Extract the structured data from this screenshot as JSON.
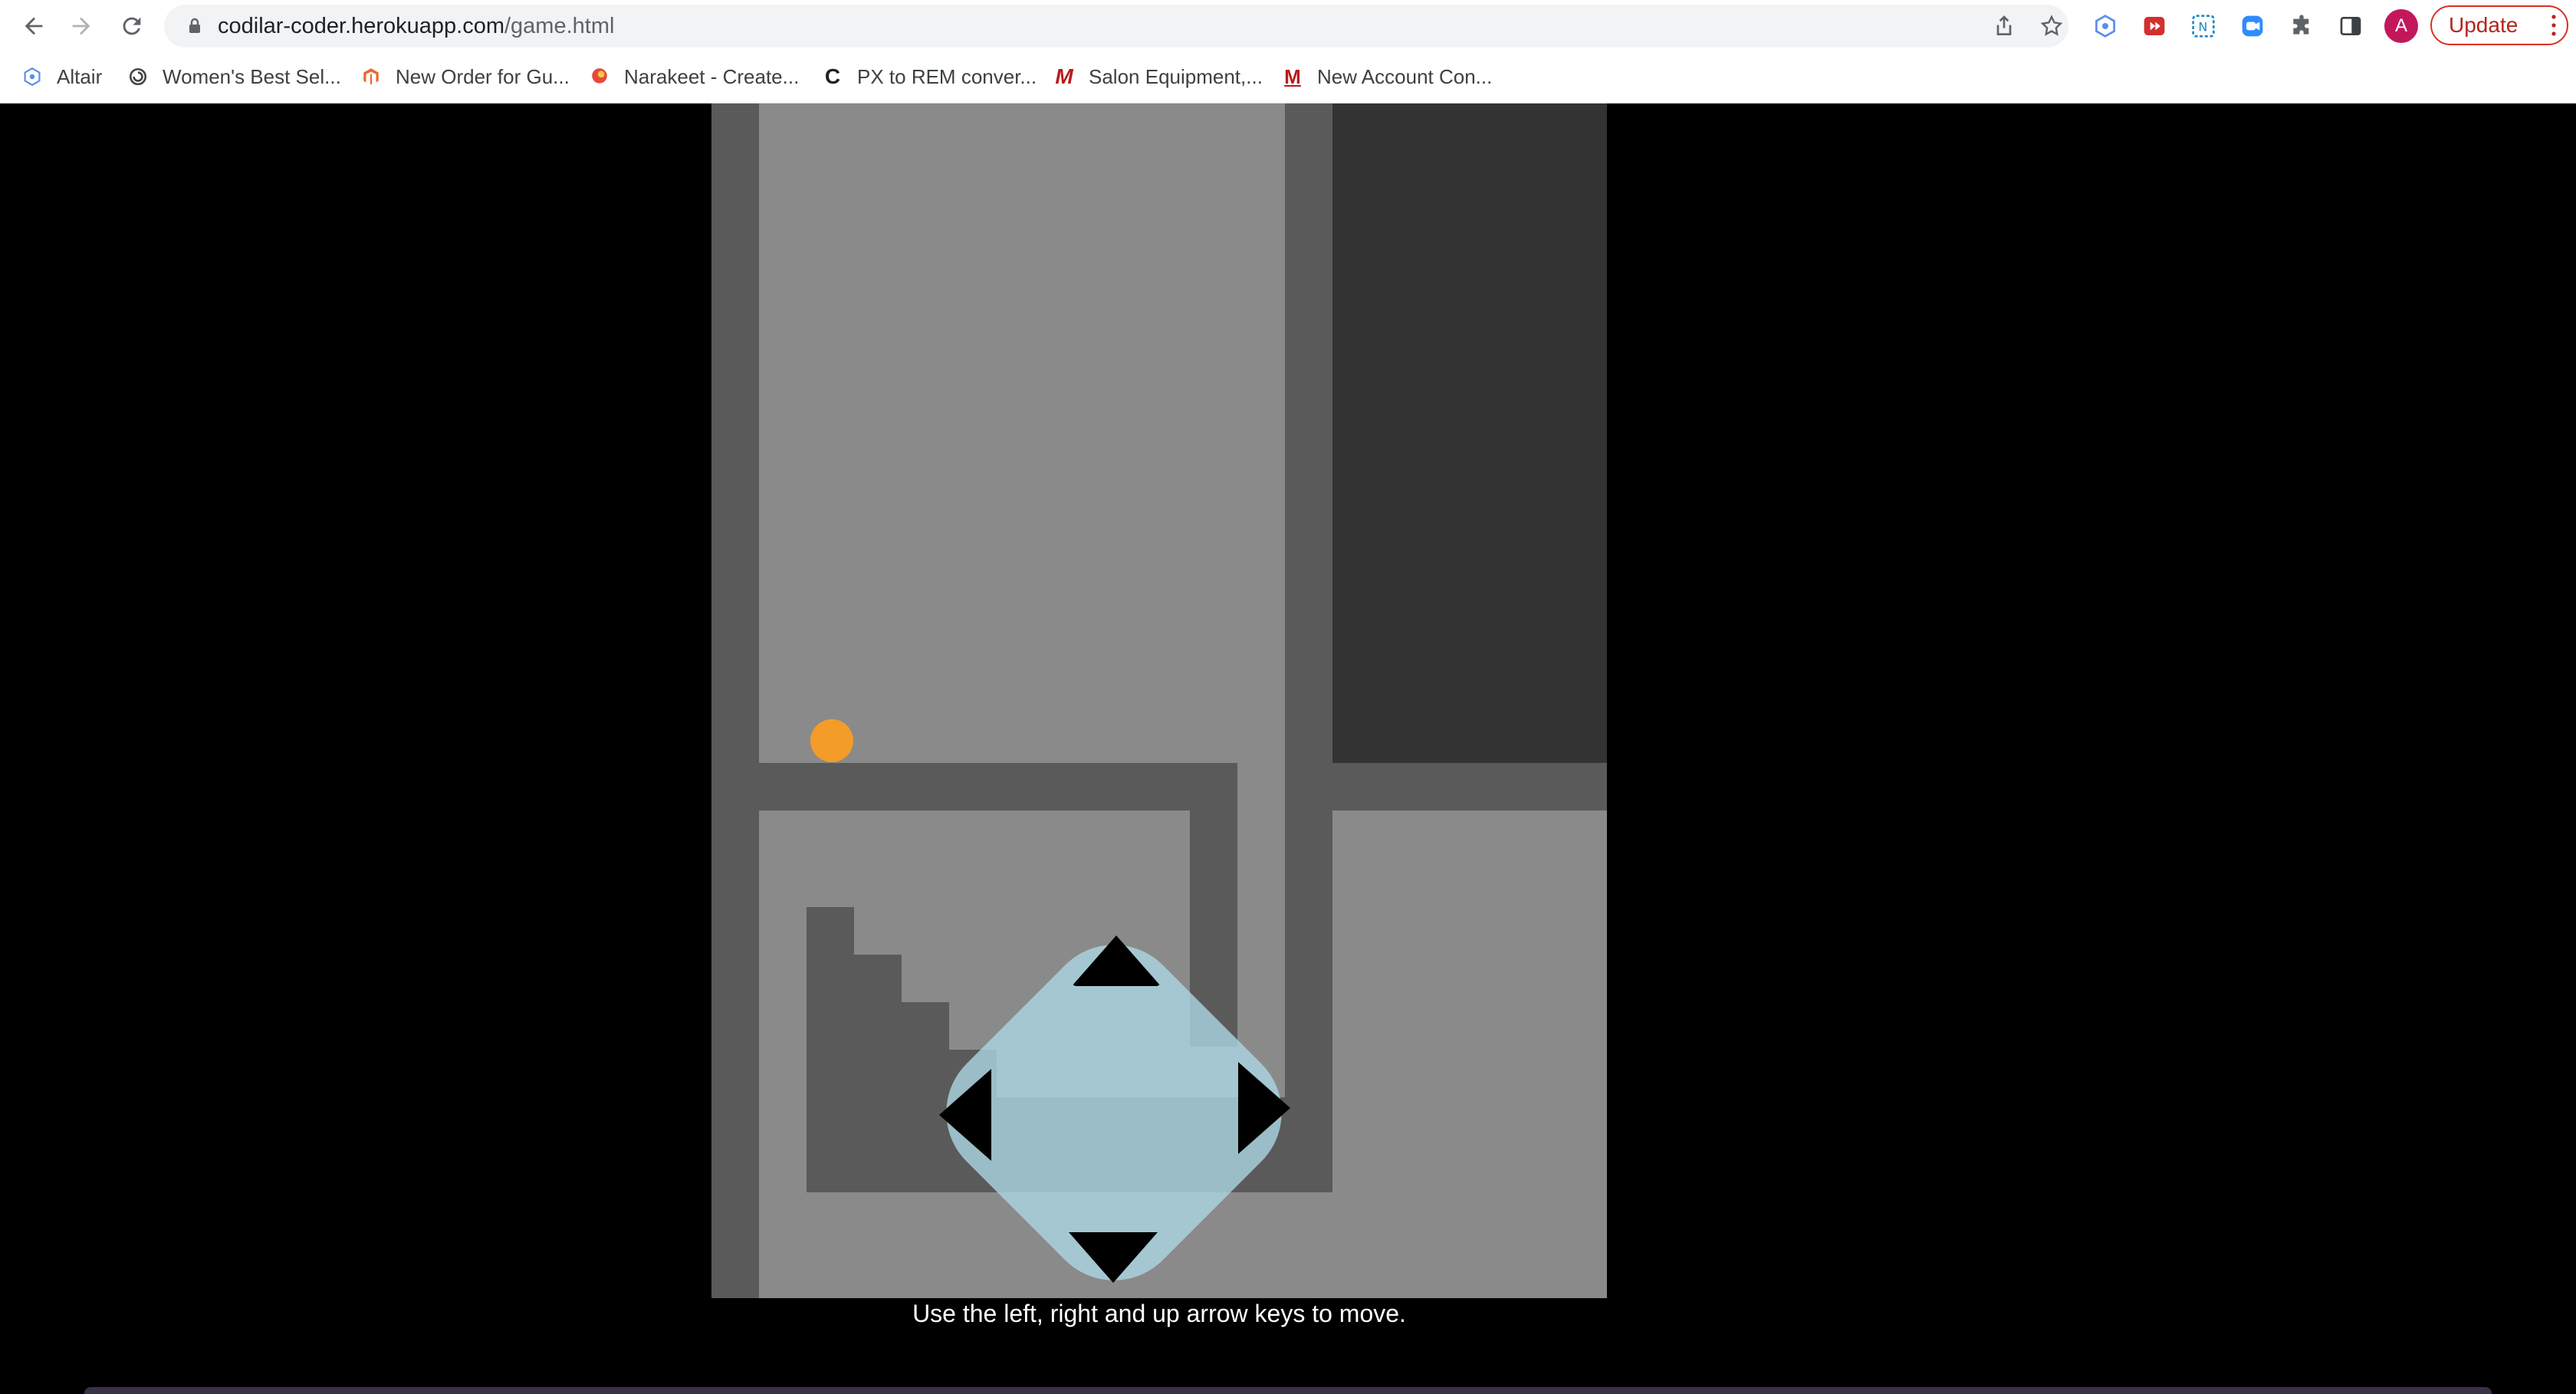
{
  "browser": {
    "url_host": "codilar-coder.herokuapp.com",
    "url_path": "/game.html",
    "update_label": "Update",
    "avatar_letter": "A",
    "nav_icons": [
      "back-arrow-icon",
      "forward-arrow-icon",
      "reload-icon"
    ],
    "extension_icons": [
      "altair-extension-icon",
      "screencast-extension-icon",
      "notion-extension-icon",
      "zoom-extension-icon",
      "puzzle-extensions-icon",
      "side-panel-icon"
    ]
  },
  "bookmarks": [
    {
      "label": "Altair",
      "icon": "altair-icon",
      "color": "#5b8def"
    },
    {
      "label": "Women's Best Sel...",
      "icon": "swirl-icon",
      "color": "#444444"
    },
    {
      "label": "New Order for Gu...",
      "icon": "magento-icon",
      "color": "#ee672f"
    },
    {
      "label": "Narakeet - Create...",
      "icon": "narakeet-icon",
      "color": "#e8493c"
    },
    {
      "label": "PX to REM conver...",
      "icon": "c-letter-icon",
      "color": "#222222"
    },
    {
      "label": "Salon Equipment,...",
      "icon": "m-letter-icon",
      "color": "#b71c1c"
    },
    {
      "label": "New Account Con...",
      "icon": "m-logo-icon",
      "color": "#b71c1c"
    }
  ],
  "game": {
    "instructions": "Use the left, right and up arrow keys to move.",
    "player_color": "#f39c2a",
    "colors": {
      "wall": "#5a5a5a",
      "background": "#8a8a8a",
      "dark_region": "#333333",
      "dpad": "#add8e6"
    },
    "controls": [
      "up-arrow-button",
      "down-arrow-button",
      "left-arrow-button",
      "right-arrow-button"
    ]
  }
}
